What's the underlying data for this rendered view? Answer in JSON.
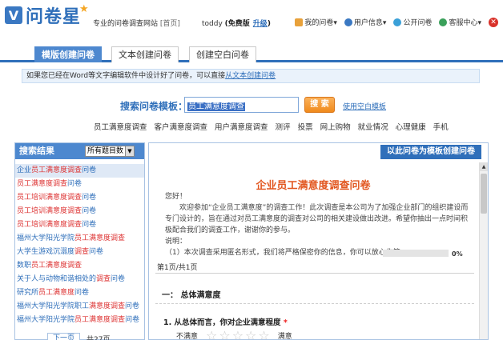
{
  "header": {
    "logo_letter": "V",
    "logo_text": "问卷星",
    "tagline": "专业的问卷调查网站",
    "home": "[首页]",
    "username": "toddy",
    "edition": "(免费版",
    "upgrade": "升级",
    "edition_close": ")",
    "nav": [
      {
        "label": "我的问卷▾",
        "icon_color": "#e8a13a"
      },
      {
        "label": "用户信息▾",
        "icon_color": "#3a78c2"
      },
      {
        "label": "公开问卷",
        "icon_color": "#3aa0d8"
      },
      {
        "label": "客服中心▾",
        "icon_color": "#3aa05a"
      }
    ],
    "close": "✕"
  },
  "tabs": [
    {
      "label": "模版创建问卷",
      "active": true
    },
    {
      "label": "文本创建问卷",
      "active": false
    },
    {
      "label": "创建空白问卷",
      "active": false
    }
  ],
  "tip": {
    "text": "如果您已经在Word等文字编辑软件中设计好了问卷，可以直接",
    "link": "从文本创建问卷"
  },
  "search": {
    "label": "搜索问卷模板：",
    "value": "员工满意度调查",
    "button": "搜 索",
    "blank_link": "使用空白模板"
  },
  "categories": [
    "员工满意度调查",
    "客户满意度调查",
    "用户满意度调查",
    "测评",
    "投票",
    "网上购物",
    "就业情况",
    "心理健康",
    "手机"
  ],
  "left": {
    "title": "搜索结果",
    "select": "所有题目数",
    "results": [
      "企业员工满意度调查问卷",
      "员工满意度调查问卷",
      "员工培训满意度调查问卷",
      "员工培训满意度调查问卷",
      "员工培训满意度调查问卷",
      "福州大学阳光学院员工满意度调查",
      "大学生游戏沉溺度调查问卷",
      "数职员工满意度调查",
      "关于人与动物和谐相处的调查问卷",
      "研究所员工满意度问卷",
      "福州大学阳光学院职工满意度调查问卷",
      "福州大学阳光学院员工满意度调查问卷"
    ],
    "prev": "下一页",
    "total": "共27页"
  },
  "right": {
    "use_button": "以此问卷为模板创建问卷",
    "title": "企业员工满意度调查问卷",
    "greeting": "您好！",
    "intro": "欢迎参加“企业员工满意度”的调查工作！此次调查是本公司为了加强企业部门的组织建设而专门设计的，旨在通过对员工满意度的调查对公司的相关建设做出改进。希望你抽出一点时间积极配合我们的调查工作，谢谢你的参与。",
    "note_label": "说明：",
    "note": "（1）本次调查采用匿名形式，我们将严格保密你的信息，你可以放心作答。",
    "progress": "0%",
    "progress_value": 0,
    "page": "第1页/共1页",
    "section": "一：  总体满意度",
    "question": "1.   从总体而言，你对企业满意程度",
    "required": "*",
    "low": "不满意",
    "high": "满意"
  }
}
